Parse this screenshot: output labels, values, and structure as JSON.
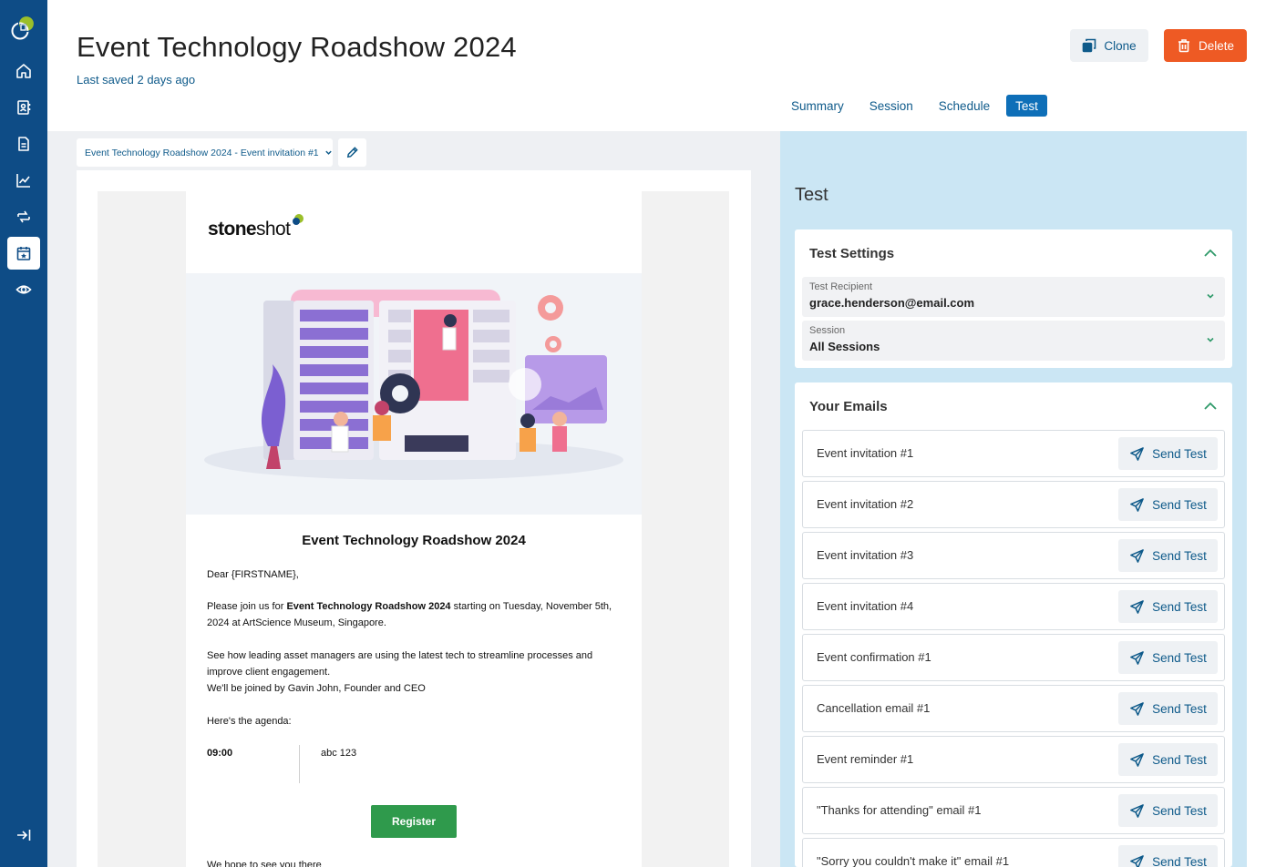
{
  "header": {
    "title": "Event Technology Roadshow 2024",
    "last_saved": "Last saved 2 days ago",
    "clone_label": "Clone",
    "delete_label": "Delete"
  },
  "sidebar": {
    "items": [
      {
        "name": "home",
        "icon": "home-icon",
        "active": false
      },
      {
        "name": "contacts",
        "icon": "contacts-book-icon",
        "active": false
      },
      {
        "name": "documents",
        "icon": "document-icon",
        "active": false
      },
      {
        "name": "analytics",
        "icon": "line-chart-icon",
        "active": false
      },
      {
        "name": "automation",
        "icon": "refresh-cycle-icon",
        "active": false
      },
      {
        "name": "events",
        "icon": "calendar-star-icon",
        "active": true
      },
      {
        "name": "preview",
        "icon": "eye-icon",
        "active": false
      }
    ],
    "collapse_icon": "expand-sidebar-icon"
  },
  "tabs": [
    {
      "label": "Summary",
      "active": false
    },
    {
      "label": "Session",
      "active": false
    },
    {
      "label": "Schedule",
      "active": false
    },
    {
      "label": "Test",
      "active": true
    }
  ],
  "email_selector": {
    "value": "Event Technology Roadshow 2024 - Event invitation #1"
  },
  "email_preview": {
    "brand_strong": "stone",
    "brand_light": "shot",
    "heading": "Event Technology Roadshow 2024",
    "greeting": "Dear {FIRSTNAME},",
    "para1_prefix": "Please join us for ",
    "para1_bold": "Event Technology Roadshow 2024",
    "para1_suffix": " starting on Tuesday, November 5th, 2024 at ArtScience Museum, Singapore.",
    "para2": "See how leading asset managers are using the latest tech to streamline processes and improve client engagement.",
    "para3": "We'll be joined by Gavin John, Founder and CEO",
    "agenda_intro": "Here's the agenda:",
    "agenda": [
      {
        "time": "09:00",
        "item": "abc 123"
      }
    ],
    "register_label": "Register",
    "footer_text": "We hope to see you there"
  },
  "test_panel": {
    "title": "Test",
    "settings": {
      "title": "Test Settings",
      "recipient_label": "Test Recipient",
      "recipient_value": "grace.henderson@email.com",
      "session_label": "Session",
      "session_value": "All Sessions"
    },
    "emails": {
      "title": "Your Emails",
      "send_label": "Send Test",
      "items": [
        "Event invitation #1",
        "Event invitation #2",
        "Event invitation #3",
        "Event invitation #4",
        "Event confirmation #1",
        "Cancellation email #1",
        "Event reminder #1",
        "\"Thanks for attending\" email #1",
        "\"Sorry you couldn't make it\" email #1"
      ]
    }
  },
  "colors": {
    "sidebar": "#0e4c86",
    "accent": "#0e6fb8",
    "delete": "#ee5a24",
    "register": "#2f9a4c",
    "panel": "#cbe6f4"
  }
}
